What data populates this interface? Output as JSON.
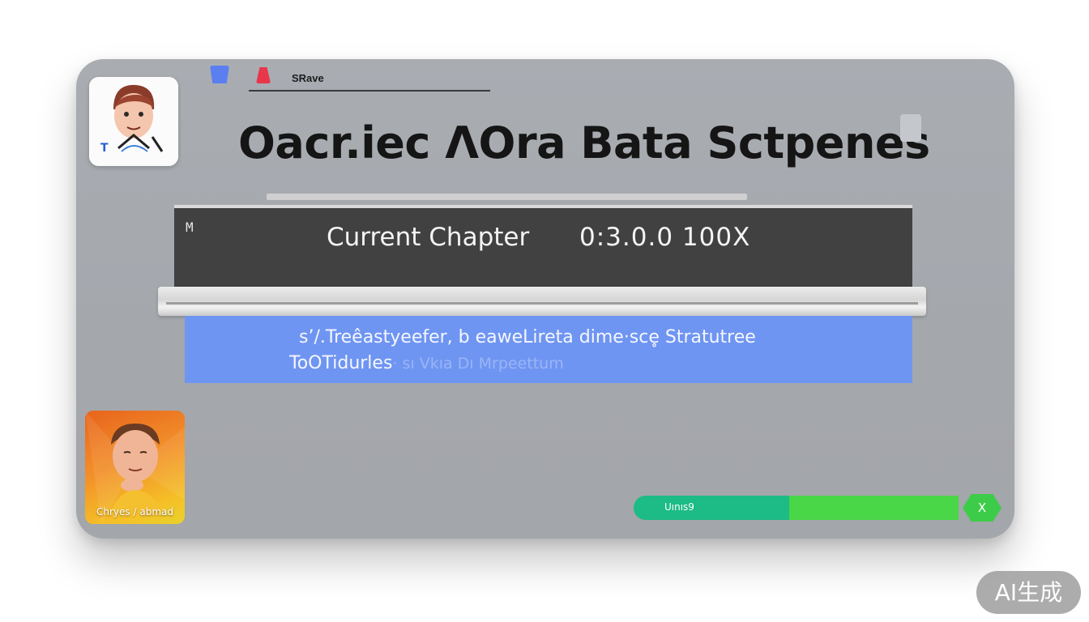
{
  "header": {
    "save_label": "SRave",
    "title": "Oacr.iec ΛOra Bata Sctpenes"
  },
  "chapter": {
    "marker": "M",
    "label": "Current Chapter",
    "value": "0:3.0.0 100X"
  },
  "info": {
    "line1": "s’/.Treêastyeefer, b eaweLireta dime·sce̥ Stratutree",
    "line2": "ToOTidurles",
    "line2_faded": "· sı Vkıa Dı Mrpeettum"
  },
  "avatar_bottom": {
    "caption": "Chryes / abmad"
  },
  "progress": {
    "label": "Uınıs9",
    "fraction": 0.48,
    "close_label": "X"
  },
  "watermark": {
    "text": "AI生成"
  },
  "colors": {
    "window_bg": "#a6a9ae",
    "chapter_bg": "#414141",
    "info_bg": "#6f95f2",
    "progress_fill": "#1dbb86",
    "progress_track": "#49d647",
    "tab_blue": "#5b7ff0",
    "tab_red": "#e8364a"
  },
  "icons": {
    "avatar_top": "cartoon-man-avatar-icon",
    "avatar_bottom": "cartoon-man-avatar-icon",
    "tab_blue": "blue-tab-icon",
    "tab_red": "red-tab-icon",
    "close": "close-icon"
  }
}
